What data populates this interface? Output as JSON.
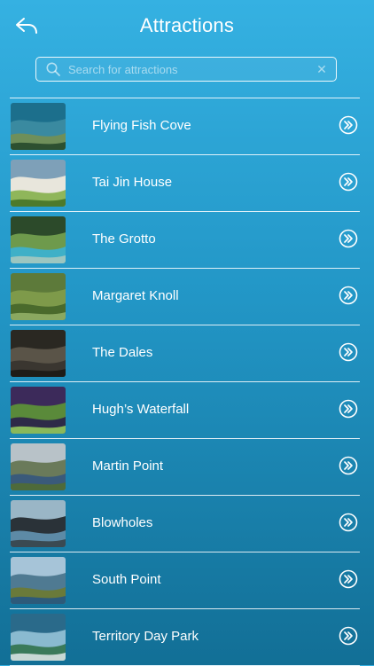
{
  "header": {
    "title": "Attractions",
    "back_icon": "back-arrow-icon"
  },
  "search": {
    "placeholder": "Search for attractions",
    "value": "",
    "clear_label": "✕"
  },
  "attractions": [
    {
      "name": "Flying Fish Cove",
      "thumb_colors": [
        "#1c6f8c",
        "#3a8aa0",
        "#6f8f5a",
        "#2d5030"
      ]
    },
    {
      "name": "Tai Jin House",
      "thumb_colors": [
        "#7ea0b8",
        "#e8e6dc",
        "#8fb65a",
        "#4d7a2c"
      ]
    },
    {
      "name": "The Grotto",
      "thumb_colors": [
        "#2c4a2a",
        "#6e9a4c",
        "#3fb0c7",
        "#9cc6c0"
      ]
    },
    {
      "name": "Margaret Knoll",
      "thumb_colors": [
        "#5d7a3a",
        "#7e9a4a",
        "#4a6a2c",
        "#8aa860"
      ]
    },
    {
      "name": "The Dales",
      "thumb_colors": [
        "#2a2822",
        "#5a5448",
        "#3a3630",
        "#1e1c18"
      ]
    },
    {
      "name": "Hugh’s Waterfall",
      "thumb_colors": [
        "#3c2a5a",
        "#5a8a3a",
        "#2e2a48",
        "#8ab85a"
      ]
    },
    {
      "name": "Martin Point",
      "thumb_colors": [
        "#b8c2c8",
        "#6a7a5a",
        "#3a5a7a",
        "#4e6a3a"
      ]
    },
    {
      "name": "Blowholes",
      "thumb_colors": [
        "#9ab6c6",
        "#2a3238",
        "#5d8aa6",
        "#3a4a52"
      ]
    },
    {
      "name": "South Point",
      "thumb_colors": [
        "#a6c4d8",
        "#4f7a92",
        "#6a7a3a",
        "#2d5a7a"
      ]
    },
    {
      "name": "Territory Day Park",
      "thumb_colors": [
        "#2a6a8a",
        "#8abad0",
        "#3a7a5a",
        "#c8d8d4"
      ]
    }
  ]
}
